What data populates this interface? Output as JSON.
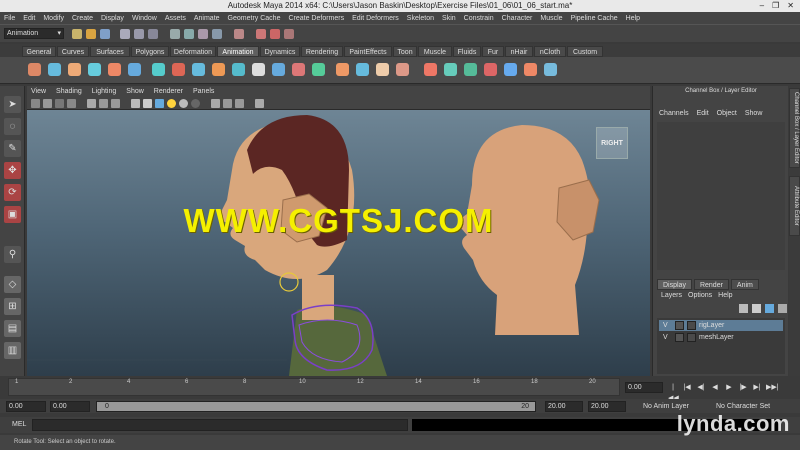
{
  "window": {
    "title": "Autodesk Maya 2014 x64: C:\\Users\\Jason Baskin\\Desktop\\Exercise Files\\01_06\\01_06_start.ma*",
    "minimize": "–",
    "maximize": "❐",
    "close": "✕"
  },
  "menubar": [
    "File",
    "Edit",
    "Modify",
    "Create",
    "Display",
    "Window",
    "Assets",
    "Animate",
    "Geometry Cache",
    "Create Deformers",
    "Edit Deformers",
    "Skeleton",
    "Skin",
    "Constrain",
    "Character",
    "Muscle",
    "Pipeline Cache",
    "Help"
  ],
  "statusline": {
    "mode": "Animation"
  },
  "shelf": {
    "tabs": [
      "General",
      "Curves",
      "Surfaces",
      "Polygons",
      "Deformation",
      "Animation",
      "Dynamics",
      "Rendering",
      "PaintEffects",
      "Toon",
      "Muscle",
      "Fluids",
      "Fur",
      "nHair",
      "nCloth",
      "Custom"
    ],
    "active": "Animation"
  },
  "panel": {
    "menu": [
      "View",
      "Shading",
      "Lighting",
      "Show",
      "Renderer",
      "Panels"
    ],
    "view_label": "RIGHT",
    "watermark": "WWW.CGTSJ.COM"
  },
  "channelbox": {
    "title": "Channel Box / Layer Editor",
    "menu": [
      "Channels",
      "Edit",
      "Object",
      "Show"
    ],
    "layer_tabs": [
      "Display",
      "Render",
      "Anim"
    ],
    "layer_menu": [
      "Layers",
      "Options",
      "Help"
    ],
    "layers": [
      {
        "v": "V",
        "name": "rigLayer",
        "selected": true
      },
      {
        "v": "V",
        "name": "meshLayer",
        "selected": false
      }
    ],
    "side_tabs": [
      "Channel Box / Layer Editor",
      "Attribute Editor"
    ]
  },
  "timeline": {
    "ticks": [
      "1",
      "2",
      "4",
      "6",
      "8",
      "10",
      "12",
      "14",
      "16",
      "18",
      "20"
    ],
    "current": "0.00",
    "playback": [
      "|◀◀",
      "|◀",
      "◀|",
      "◀",
      "▶",
      "|▶",
      "▶|",
      "▶▶|"
    ]
  },
  "range": {
    "start": "0.00",
    "playback_start": "0.00",
    "slider_lo": "0",
    "slider_hi": "20",
    "playback_end": "20.00",
    "end": "20.00",
    "anim_layer": "No Anim Layer",
    "character_set": "No Character Set"
  },
  "cmdline": {
    "label": "MEL"
  },
  "helpline": {
    "text": "Rotate Tool: Select an object to rotate."
  },
  "brand": "lynda.com"
}
